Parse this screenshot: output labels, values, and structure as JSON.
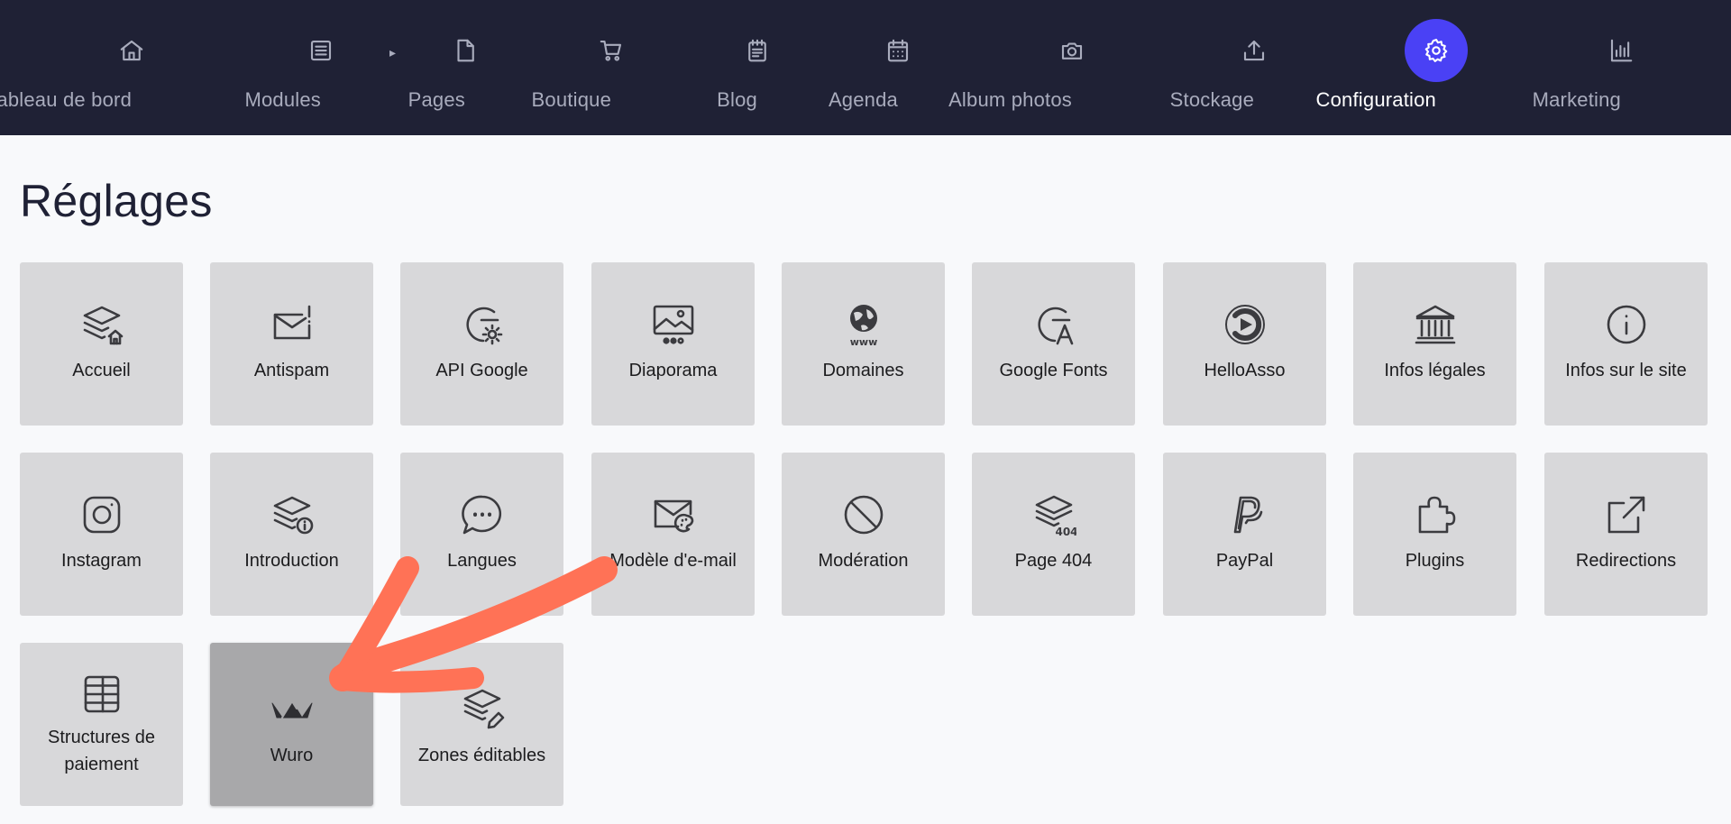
{
  "nav": {
    "items": [
      {
        "label": "Tableau de bord",
        "icon": "home-icon"
      },
      {
        "label": "Modules",
        "icon": "list-icon"
      },
      {
        "label": "Pages",
        "icon": "file-icon"
      },
      {
        "label": "Boutique",
        "icon": "cart-icon"
      },
      {
        "label": "Blog",
        "icon": "notepad-icon"
      },
      {
        "label": "Agenda",
        "icon": "calendar-icon"
      },
      {
        "label": "Album photos",
        "icon": "camera-icon"
      },
      {
        "label": "Stockage",
        "icon": "upload-icon"
      },
      {
        "label": "Configuration",
        "icon": "gear-icon",
        "active": true
      },
      {
        "label": "Marketing",
        "icon": "bar-chart-icon"
      }
    ],
    "separator": "▸"
  },
  "page": {
    "title": "Réglages"
  },
  "tiles": [
    {
      "label": "Accueil",
      "icon": "layers-home-icon"
    },
    {
      "label": "Antispam",
      "icon": "mail-alert-icon"
    },
    {
      "label": "API Google",
      "icon": "google-gear-icon"
    },
    {
      "label": "Diaporama",
      "icon": "slideshow-icon"
    },
    {
      "label": "Domaines",
      "icon": "globe-www-icon"
    },
    {
      "label": "Google Fonts",
      "icon": "google-font-icon"
    },
    {
      "label": "HelloAsso",
      "icon": "helloasso-icon"
    },
    {
      "label": "Infos légales",
      "icon": "bank-icon"
    },
    {
      "label": "Infos sur le site",
      "icon": "info-circle-icon"
    },
    {
      "label": "Instagram",
      "icon": "instagram-icon"
    },
    {
      "label": "Introduction",
      "icon": "layers-info-icon"
    },
    {
      "label": "Langues",
      "icon": "chat-bubble-icon"
    },
    {
      "label": "Modèle d'e-mail",
      "icon": "mail-palette-icon"
    },
    {
      "label": "Modération",
      "icon": "ban-icon"
    },
    {
      "label": "Page 404",
      "icon": "layers-404-icon"
    },
    {
      "label": "PayPal",
      "icon": "paypal-icon"
    },
    {
      "label": "Plugins",
      "icon": "puzzle-icon"
    },
    {
      "label": "Redirections",
      "icon": "external-link-icon"
    },
    {
      "label": "Structures de paiement",
      "icon": "database-icon"
    },
    {
      "label": "Wuro",
      "icon": "wuro-logo-icon",
      "selected": true
    },
    {
      "label": "Zones éditables",
      "icon": "layers-edit-icon"
    }
  ],
  "icon_badges": {
    "www": "www",
    "four_oh_four": "404"
  },
  "colors": {
    "nav_bg": "#1f2135",
    "nav_text": "#a9acbd",
    "accent": "#4a41f5",
    "tile_bg": "#d8d8da",
    "tile_selected_bg": "#a8a8aa",
    "arrow": "#ff7256"
  }
}
